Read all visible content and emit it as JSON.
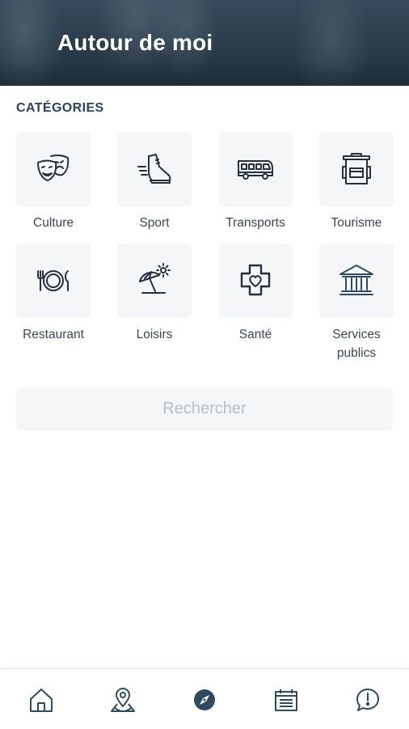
{
  "header": {
    "title": "Autour de moi"
  },
  "section": {
    "title": "CATÉGORIES"
  },
  "categories": [
    {
      "label": "Culture",
      "icon": "theater-masks-icon"
    },
    {
      "label": "Sport",
      "icon": "sneaker-icon"
    },
    {
      "label": "Transports",
      "icon": "bus-icon"
    },
    {
      "label": "Tourisme",
      "icon": "backpack-icon"
    },
    {
      "label": "Restaurant",
      "icon": "plate-cutlery-icon"
    },
    {
      "label": "Loisirs",
      "icon": "beach-umbrella-icon"
    },
    {
      "label": "Santé",
      "icon": "medical-cross-heart-icon"
    },
    {
      "label": "Services publics",
      "icon": "public-building-icon"
    }
  ],
  "search": {
    "label": "Rechercher"
  },
  "nav": {
    "items": [
      {
        "icon": "home-icon",
        "active": false
      },
      {
        "icon": "map-pin-icon",
        "active": false
      },
      {
        "icon": "compass-icon",
        "active": true
      },
      {
        "icon": "calendar-icon",
        "active": false
      },
      {
        "icon": "chat-alert-icon",
        "active": false
      }
    ]
  },
  "colors": {
    "header_bg": "#2a3b4a",
    "icon_stroke": "#24313d",
    "nav_icon": "#2e4a5e",
    "tile_bg": "#f5f6f8",
    "search_text": "#b9bec4"
  }
}
